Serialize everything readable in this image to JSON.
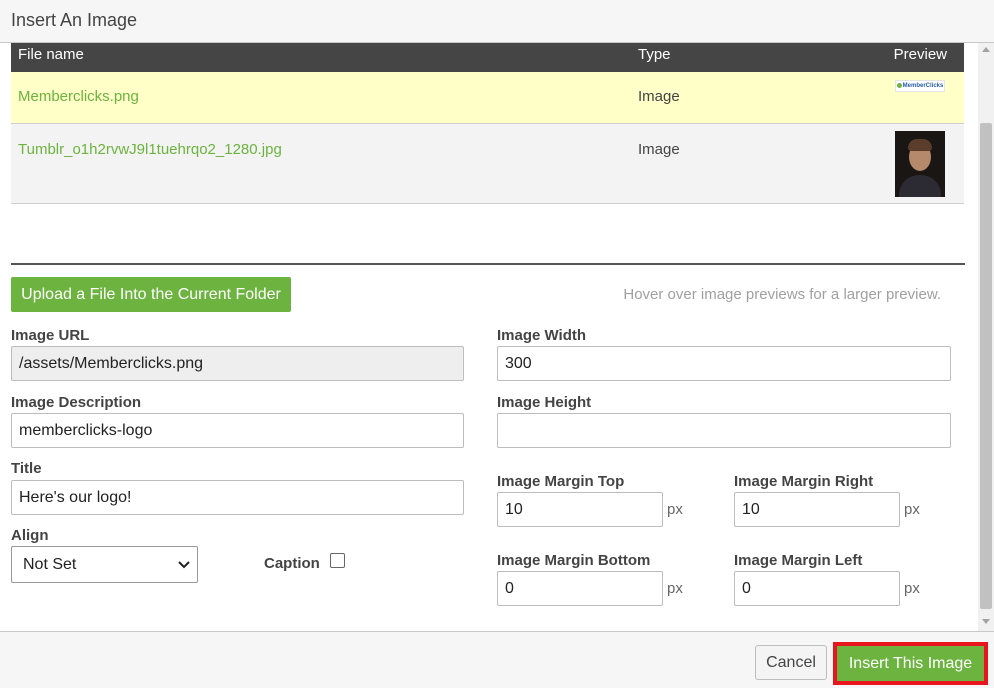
{
  "dialog": {
    "title": "Insert An Image"
  },
  "file_table": {
    "columns": {
      "name": "File name",
      "type": "Type",
      "preview": "Preview"
    },
    "rows": [
      {
        "name": "Memberclicks.png",
        "type": "Image",
        "preview_icon": "memberclicks-logo-thumbnail",
        "selected": true
      },
      {
        "name": "Tumblr_o1h2rvwJ9l1tuehrqo2_1280.jpg",
        "type": "Image",
        "preview_icon": "portrait-photo-thumbnail",
        "selected": false
      }
    ]
  },
  "thumb_logo_text": "MemberClicks",
  "upload": {
    "label": "Upload a File Into the Current Folder"
  },
  "hint": "Hover over image previews for a larger preview.",
  "form": {
    "image_url": {
      "label": "Image URL",
      "value": "/assets/Memberclicks.png"
    },
    "image_description": {
      "label": "Image Description",
      "value": "memberclicks-logo"
    },
    "title": {
      "label": "Title",
      "value": "Here's our logo!"
    },
    "align": {
      "label": "Align",
      "value": "Not Set"
    },
    "caption": {
      "label": "Caption",
      "checked": false
    },
    "image_width": {
      "label": "Image Width",
      "value": "300"
    },
    "image_height": {
      "label": "Image Height",
      "value": ""
    },
    "margin_top": {
      "label": "Image Margin Top",
      "value": "10"
    },
    "margin_right": {
      "label": "Image Margin Right",
      "value": "10"
    },
    "margin_bottom": {
      "label": "Image Margin Bottom",
      "value": "0"
    },
    "margin_left": {
      "label": "Image Margin Left",
      "value": "0"
    },
    "unit": "px"
  },
  "footer": {
    "cancel_label": "Cancel",
    "insert_label": "Insert This Image"
  },
  "colors": {
    "accent_green": "#6cb33f",
    "highlight_red": "#e8141e",
    "selected_row": "#ffffc8",
    "table_header": "#454545"
  }
}
